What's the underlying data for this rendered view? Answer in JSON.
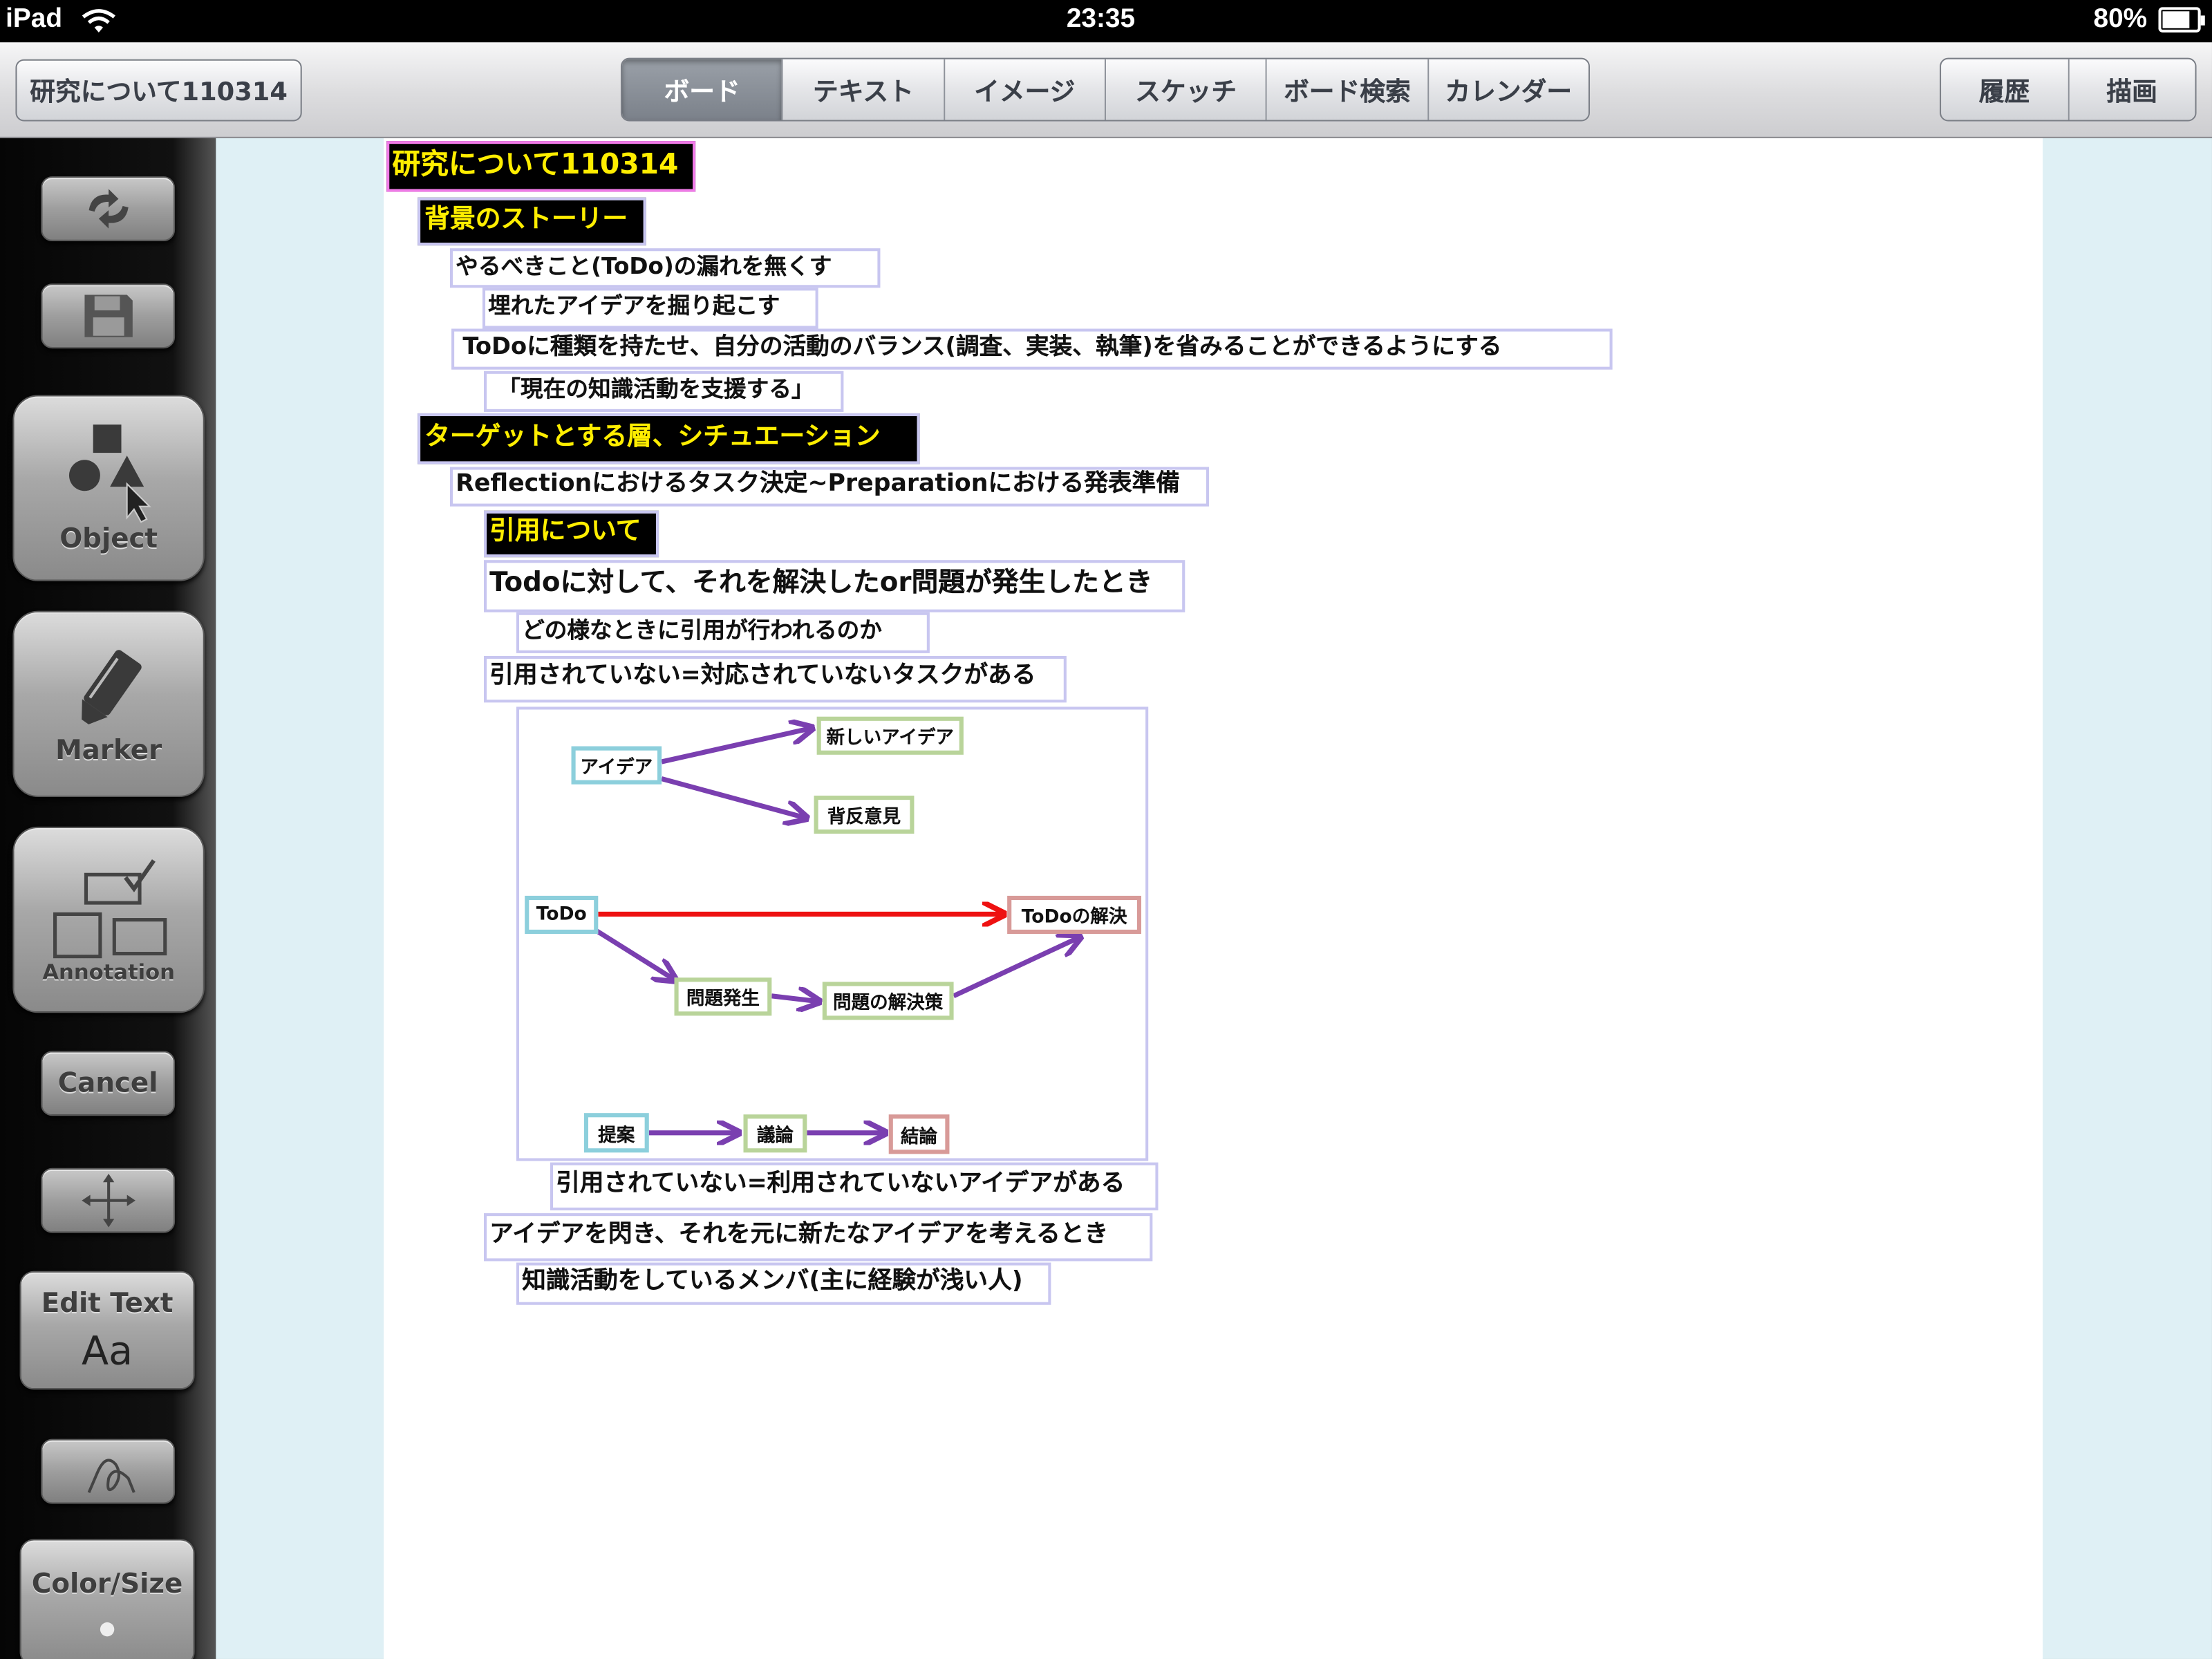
{
  "status_bar": {
    "device": "iPad",
    "time": "23:35",
    "battery": "80%"
  },
  "nav": {
    "title_button": "研究について110314",
    "tabs": [
      "ボード",
      "テキスト",
      "イメージ",
      "スケッチ",
      "ボード検索",
      "カレンダー"
    ],
    "active_tab": "ボード",
    "right_buttons": [
      "履歴",
      "描画"
    ]
  },
  "toolbar": {
    "object": "Object",
    "marker": "Marker",
    "annotation": "Annotation",
    "cancel": "Cancel",
    "edit_text": "Edit Text",
    "edit_text_sub": "Aa",
    "color_size": "Color/Size"
  },
  "board": {
    "nodes": [
      "研究について110314",
      "背景のストーリー",
      "やるべきこと(ToDo)の漏れを無くす",
      "埋れたアイデアを掘り起こす",
      "ToDoに種類を持たせ、自分の活動のバランス(調査、実装、執筆)を省みることができるようにする",
      "「現在の知識活動を支援する」",
      "ターゲットとする層、シチュエーション",
      "Reflectionにおけるタスク決定~Preparationにおける発表準備",
      "引用について",
      "Todoに対して、それを解決したor問題が発生したとき",
      "どの様なときに引用が行われるのか",
      "引用されていない=対応されていないタスクがある",
      "引用されていない=利用されていないアイデアがある",
      "アイデアを閃き、それを元に新たなアイデアを考えるとき",
      "知識活動をしているメンバ(主に経験が浅い人)"
    ],
    "diagram_boxes": [
      "アイデア",
      "新しいアイデア",
      "背反意見",
      "ToDo",
      "ToDoの解決",
      "問題発生",
      "問題の解決策",
      "提案",
      "議論",
      "結論"
    ]
  },
  "colors": {
    "heading_bg": "#000000",
    "heading_text": "#ffee00",
    "node_border": "#c8c6f0",
    "arrow_purple": "#7a3fb0",
    "arrow_red": "#ee1111"
  }
}
